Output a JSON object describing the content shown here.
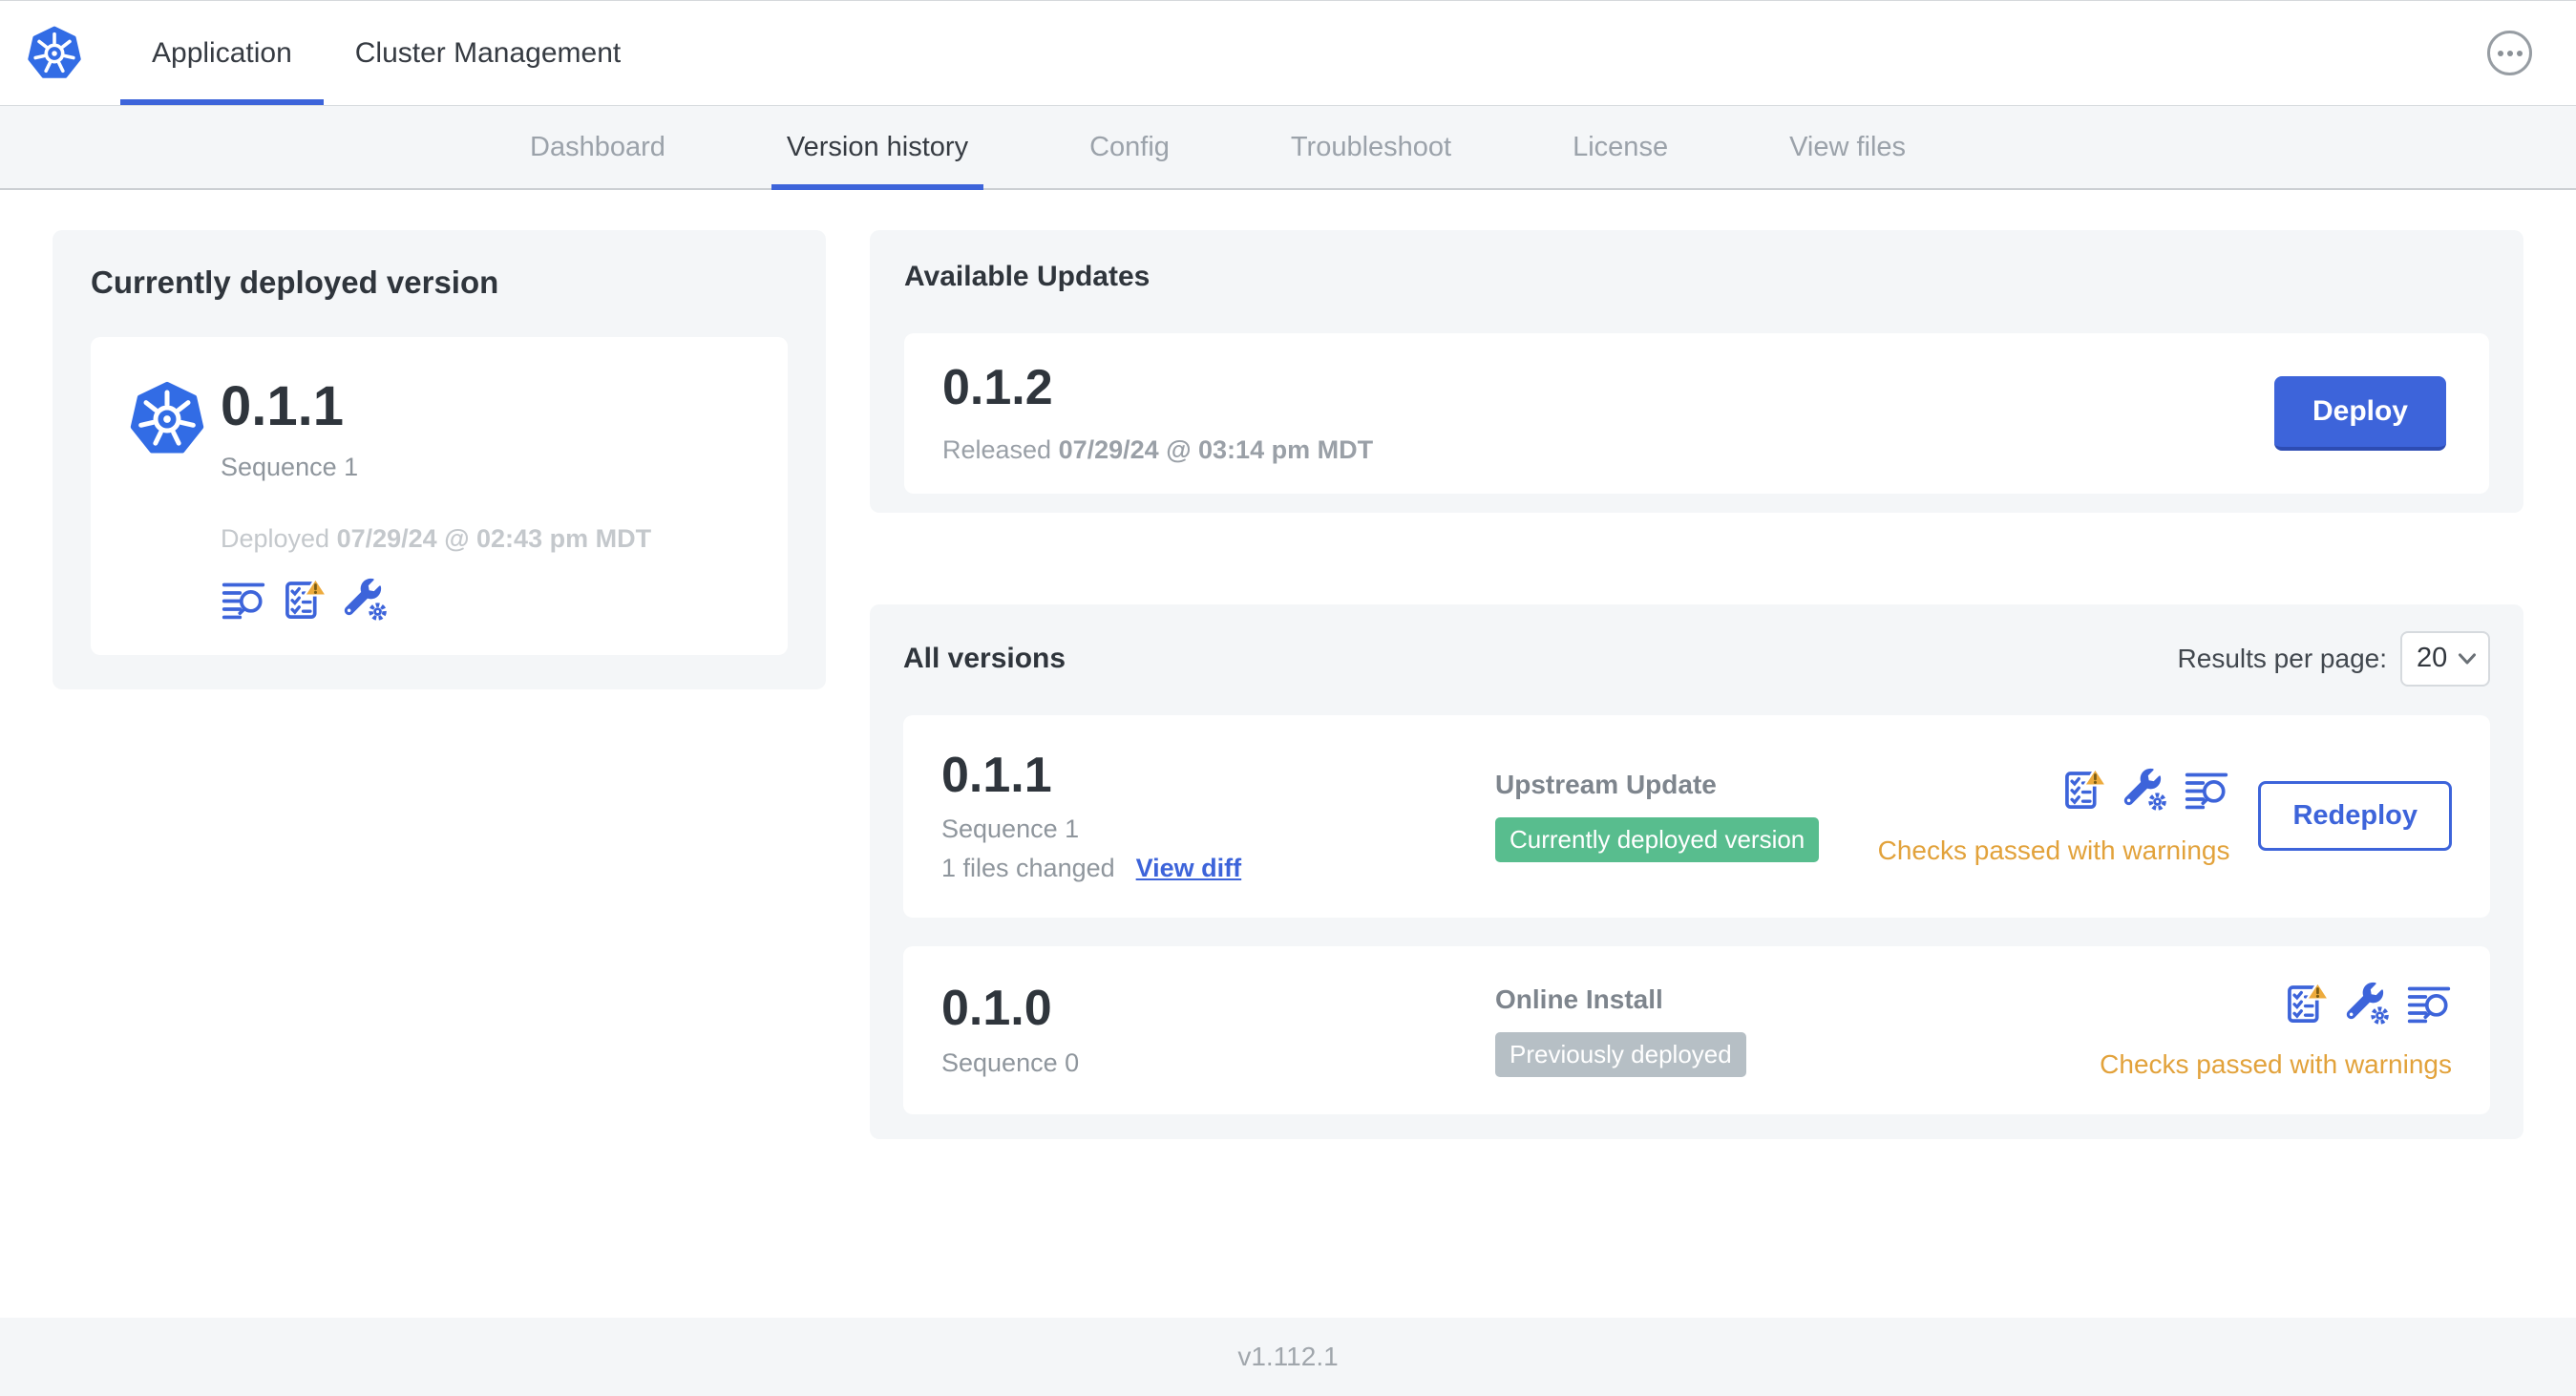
{
  "colors": {
    "accent": "#3d64da",
    "k8s_blue": "#326CE5",
    "badge_green": "#58bd8e",
    "badge_gray": "#b6bfc5",
    "warning_text": "#e2a23b",
    "warning_triangle": "#edab3d"
  },
  "header": {
    "nav_tabs": [
      {
        "label": "Application",
        "active": true
      },
      {
        "label": "Cluster Management",
        "active": false
      }
    ]
  },
  "subnav": {
    "tabs": [
      {
        "label": "Dashboard",
        "active": false
      },
      {
        "label": "Version history",
        "active": true
      },
      {
        "label": "Config",
        "active": false
      },
      {
        "label": "Troubleshoot",
        "active": false
      },
      {
        "label": "License",
        "active": false
      },
      {
        "label": "View files",
        "active": false
      }
    ]
  },
  "deployed_card": {
    "title": "Currently deployed version",
    "version": "0.1.1",
    "sequence": "Sequence 1",
    "deployed_prefix": "Deployed",
    "deployed_date": "07/29/24 @ 02:43 pm MDT"
  },
  "available_updates": {
    "title": "Available Updates",
    "version": "0.1.2",
    "released_prefix": "Released",
    "released_date": "07/29/24 @ 03:14 pm MDT",
    "deploy_label": "Deploy"
  },
  "all_versions": {
    "title": "All versions",
    "results_per_page_label": "Results per page:",
    "results_per_page_value": "20",
    "rows": [
      {
        "version": "0.1.1",
        "sequence": "Sequence 1",
        "files_changed": "1 files changed",
        "view_diff_label": "View diff",
        "source": "Upstream Update",
        "badge": "Currently deployed version",
        "status": "Checks passed with warnings",
        "action_label": "Redeploy"
      },
      {
        "version": "0.1.0",
        "sequence": "Sequence 0",
        "source": "Online Install",
        "badge": "Previously deployed",
        "status": "Checks passed with warnings"
      }
    ]
  },
  "footer": {
    "app_version": "v1.112.1"
  }
}
